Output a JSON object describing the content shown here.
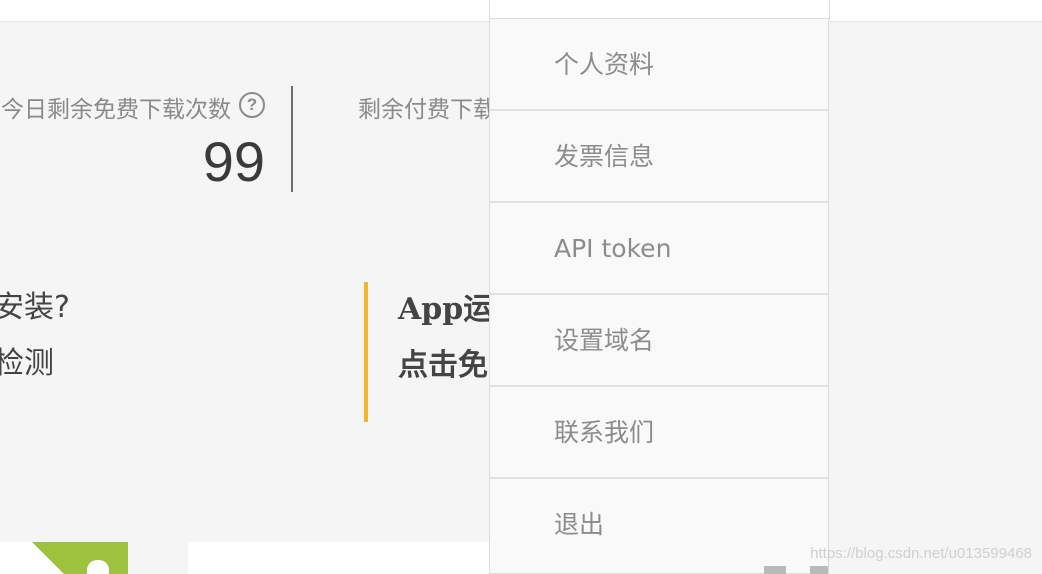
{
  "stats": {
    "free_label": "今日剩余免费下载次数",
    "help_icon": "?",
    "free_value": "99",
    "paid_label": "剩余付费下载"
  },
  "install_box": {
    "line1": "安装?",
    "line2": "检测"
  },
  "app_box": {
    "line1": "App运",
    "line2": "点击免"
  },
  "dropdown": {
    "items": [
      {
        "label": "个人资料"
      },
      {
        "label": "发票信息"
      },
      {
        "label": "API token"
      },
      {
        "label": "设置域名"
      },
      {
        "label": "联系我们"
      },
      {
        "label": "退出"
      }
    ]
  },
  "watermark": "https://blog.csdn.net/u013599468",
  "colors": {
    "accent_bar": "#f0b82e",
    "android_green": "#9dc23d"
  }
}
